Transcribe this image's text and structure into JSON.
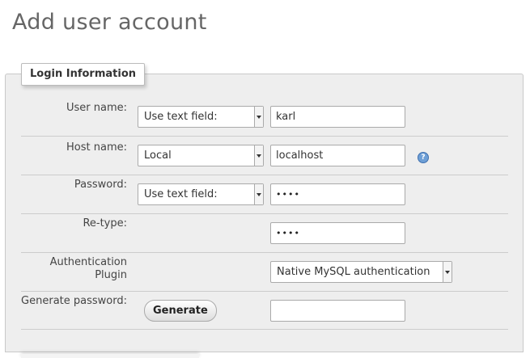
{
  "page": {
    "title": "Add user account"
  },
  "fieldset": {
    "legend": "Login Information"
  },
  "form": {
    "username": {
      "label": "User name:",
      "mode": "Use text field:",
      "value": "karl"
    },
    "hostname": {
      "label": "Host name:",
      "mode": "Local",
      "value": "localhost",
      "help_icon": "help-icon"
    },
    "password": {
      "label": "Password:",
      "mode": "Use text field:",
      "value": "••••"
    },
    "retype": {
      "label": "Re-type:",
      "value": "••••"
    },
    "auth_plugin": {
      "label_line1": "Authentication",
      "label_line2": "Plugin",
      "value": "Native MySQL authentication"
    },
    "generate": {
      "label": "Generate password:",
      "button": "Generate",
      "value": ""
    }
  }
}
